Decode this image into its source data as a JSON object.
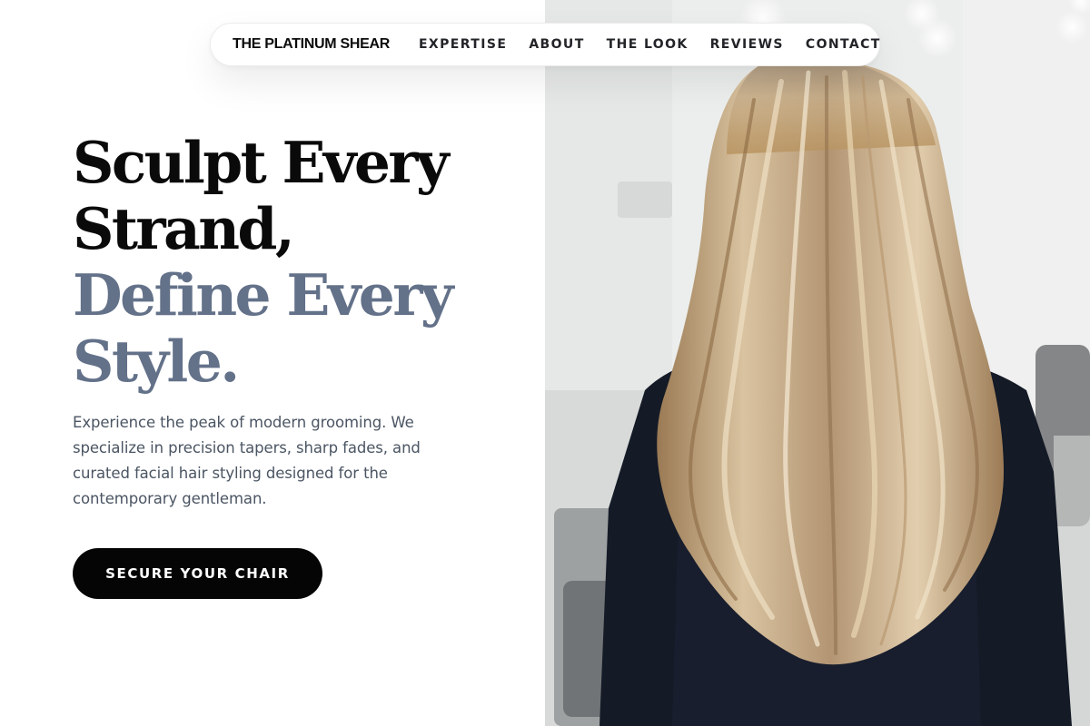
{
  "nav": {
    "brand": "THE PLATINUM SHEAR",
    "links": [
      "EXPERTISE",
      "ABOUT",
      "THE LOOK",
      "REVIEWS",
      "CONTACT"
    ]
  },
  "hero": {
    "headline_line1": "Sculpt Every",
    "headline_line2": "Strand,",
    "headline_line3": "Define Every",
    "headline_line4": "Style.",
    "description": "Experience the peak of modern grooming. We specialize in precision tapers, sharp fades, and curated facial hair styling designed for the contemporary gentleman.",
    "cta_label": "SECURE YOUR CHAIR"
  },
  "colors": {
    "accent": "#637189",
    "text_dark": "#0a0a0a",
    "text_body": "#4b5563",
    "button_bg": "#050505"
  },
  "image": {
    "subject": "back view of woman with long blonde balayage hair in salon"
  }
}
